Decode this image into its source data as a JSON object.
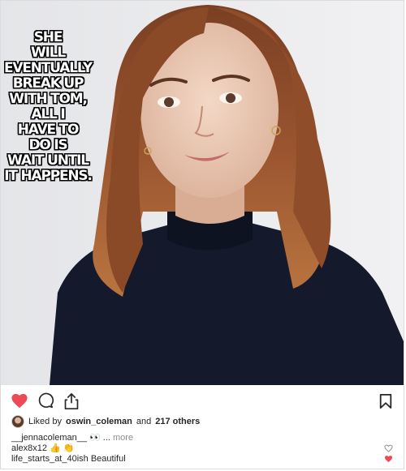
{
  "meme": {
    "caption": "SHE\nWILL\nEVENTUALLY\nBREAK UP\nWITH TOM,\nALL I\nHAVE TO\nDO IS\nWAIT UNTIL\nIT HAPPENS."
  },
  "actions": {
    "like_icon": "heart-filled-icon",
    "comment_icon": "comment-icon",
    "share_icon": "share-icon",
    "save_icon": "bookmark-icon",
    "like_color": "#ed4956"
  },
  "likes": {
    "prefix": "Liked by",
    "user": "oswin_coleman",
    "conjunction": "and",
    "others": "217 others"
  },
  "comments": [
    {
      "user": "__jennacoleman__",
      "text": "👀 ...",
      "more": "more",
      "heart": "outline"
    },
    {
      "user": "alex8x12",
      "text": "👍 👏",
      "heart": "outline"
    },
    {
      "user": "life_starts_at_40ish",
      "text": "Beautiful",
      "heart": "filled"
    }
  ]
}
